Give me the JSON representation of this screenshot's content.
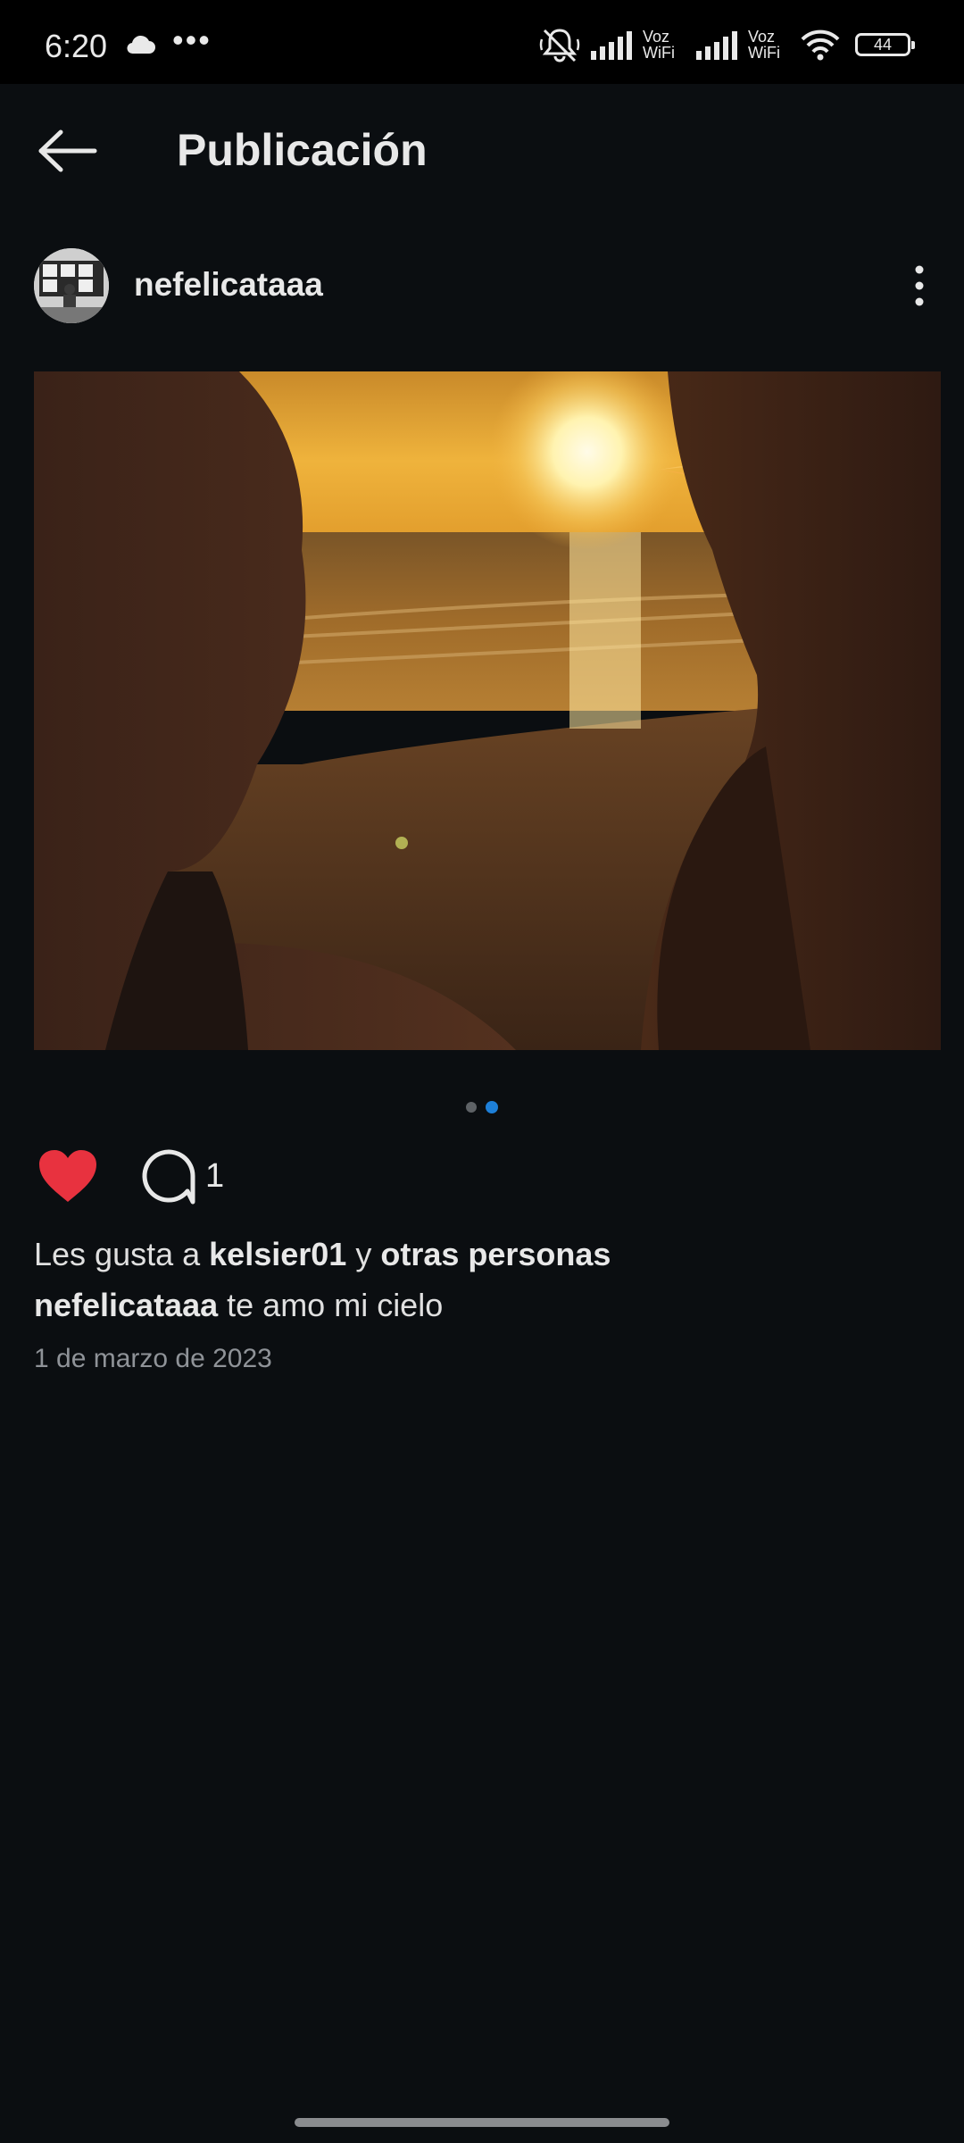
{
  "status_bar": {
    "time": "6:20",
    "dots": "•••",
    "voz_label_1": "Voz",
    "wifi_label_1": "WiFi",
    "voz_label_2": "Voz",
    "wifi_label_2": "WiFi",
    "battery_level": "44",
    "icons": [
      "cloud-icon",
      "mute-icon",
      "signal-icon",
      "signal-icon",
      "wifi-icon",
      "battery-icon"
    ]
  },
  "header": {
    "title": "Publicación",
    "back_icon": "arrow-left-icon"
  },
  "post": {
    "username": "nefelicataaa",
    "more_icon": "more-vertical-icon",
    "image_description_icon": "photo",
    "pager": {
      "count": 2,
      "active_index": 1
    },
    "actions": {
      "like_icon": "heart-icon",
      "liked": true,
      "like_color": "#e8323f",
      "comment_icon": "comment-icon",
      "comment_count": "1"
    },
    "likes": {
      "prefix": "Les gusta a",
      "user": "kelsier01",
      "connector": "y",
      "others": "otras personas"
    },
    "caption": {
      "user": "nefelicataaa",
      "text": "te amo mi cielo"
    },
    "date": "1 de marzo de 2023"
  },
  "colors": {
    "background": "#0b0e11",
    "status_bar": "#000000",
    "pager_active": "#1d7fd8",
    "pager_inactive": "#5e6266",
    "date_text": "#8f9398"
  }
}
